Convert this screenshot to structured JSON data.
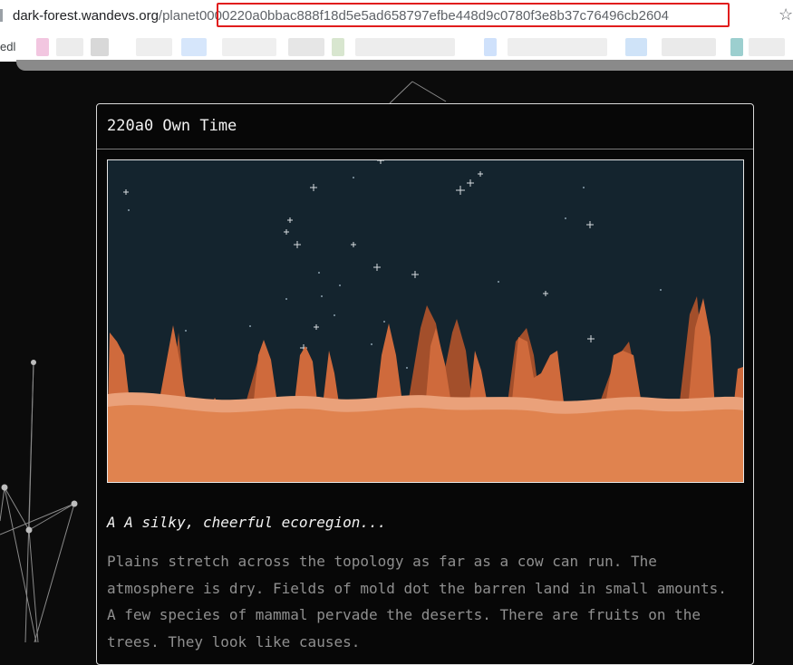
{
  "browser": {
    "url_host": "dark-forest.wandevs.org",
    "url_path": "/planet",
    "url_id": "0000220a0bbac888f18d5e5ad658797efbe448d9c0780f3e8b37c76496cb2604",
    "bookmark_fragment": "edl",
    "star_icon": "star-icon"
  },
  "planet_card": {
    "title": "220a0 Own Time",
    "ecoregion": "A A silky, cheerful ecoregion...",
    "description": "Plains stretch across the topology as far as a cow can run. The atmosphere is dry. Fields of mold dot the barren land in small amounts. A few species of mammal pervade the deserts. There are fruits on the trees. They look like causes."
  },
  "colors": {
    "sky": "#14242e",
    "ground": "#e0834f",
    "ground_band": "#eaa17a",
    "peaks": "#cf6a3c",
    "highlight": "#e11d1d"
  }
}
